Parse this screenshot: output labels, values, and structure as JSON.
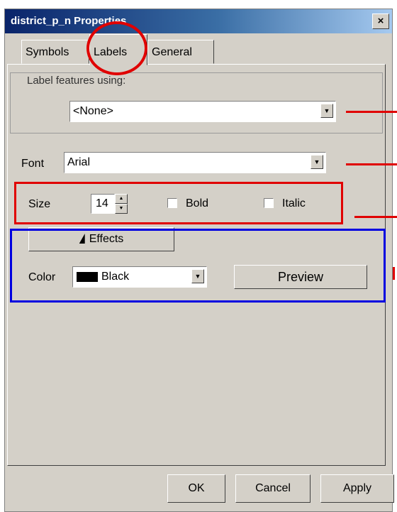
{
  "window": {
    "title": "district_p_n Properties",
    "close_glyph": "×"
  },
  "tabs": [
    {
      "label": "Symbols",
      "active": false
    },
    {
      "label": "Labels",
      "active": true
    },
    {
      "label": "General",
      "active": false
    }
  ],
  "labels_tab": {
    "group_label": "Label features using:",
    "label_field": {
      "value": "<None>"
    },
    "font": {
      "label": "Font",
      "value": "Arial"
    },
    "size": {
      "label": "Size",
      "value": "14"
    },
    "bold": {
      "label": "Bold",
      "checked": false
    },
    "italic": {
      "label": "Italic",
      "checked": false
    },
    "effects_button": "Effects",
    "color": {
      "label": "Color",
      "value": "Black",
      "swatch": "#000000"
    },
    "preview_button": "Preview"
  },
  "footer": {
    "ok": "OK",
    "cancel": "Cancel",
    "apply": "Apply"
  },
  "annotation_colors": {
    "red": "#e00000",
    "blue": "#0000e0"
  }
}
